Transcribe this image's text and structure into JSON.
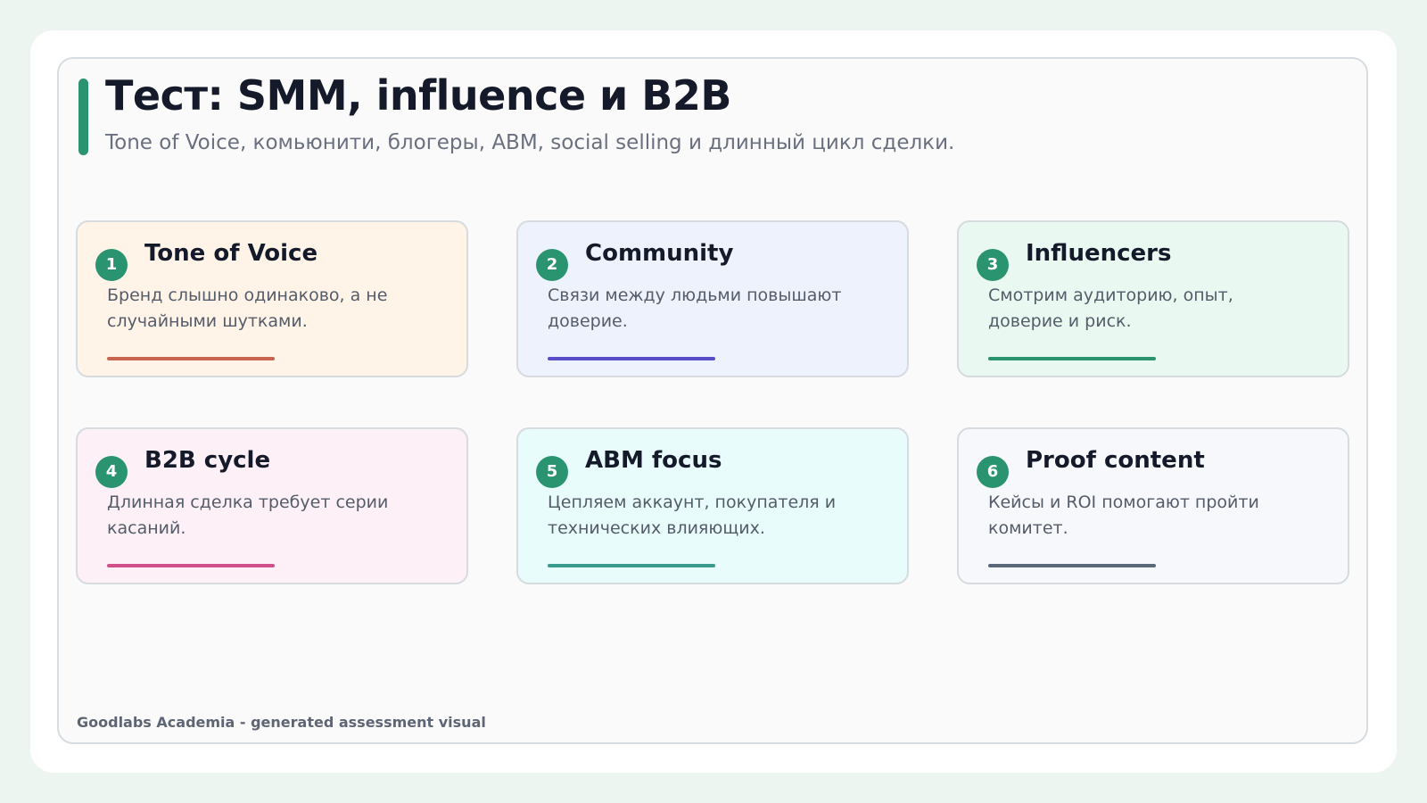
{
  "header": {
    "title": "Тест: SMM, influence и B2B",
    "subtitle": "Tone of Voice, комьюнити, блогеры, ABM, social selling и длинный цикл сделки."
  },
  "cards": [
    {
      "number": "1",
      "title": "Tone of Voice",
      "text": "Бренд слышно одинаково, а не случайными шутками.",
      "line_color": "#c8654f",
      "bg_color": "#fff4e7"
    },
    {
      "number": "2",
      "title": "Community",
      "text": "Связи между людьми повышают доверие.",
      "line_color": "#5a4ec8",
      "bg_color": "#eef2fd"
    },
    {
      "number": "3",
      "title": "Influencers",
      "text": "Смотрим аудиторию, опыт, доверие и риск.",
      "line_color": "#2a9470",
      "bg_color": "#e9f9f1"
    },
    {
      "number": "4",
      "title": "B2B cycle",
      "text": "Длинная сделка требует серии касаний.",
      "line_color": "#d0508a",
      "bg_color": "#fdf0f6"
    },
    {
      "number": "5",
      "title": "ABM focus",
      "text": "Цепляем аккаунт, покупателя и технических влияющих.",
      "line_color": "#3a9a8c",
      "bg_color": "#e8fcfc"
    },
    {
      "number": "6",
      "title": "Proof content",
      "text": "Кейсы и ROI помогают пройти комитет.",
      "line_color": "#5a6878",
      "bg_color": "#f7f8fb"
    }
  ],
  "footer": {
    "text": "Goodlabs Academia - generated assessment visual"
  },
  "colors": {
    "accent": "#2a9470",
    "background": "#edf5f0",
    "title": "#141a2a"
  }
}
